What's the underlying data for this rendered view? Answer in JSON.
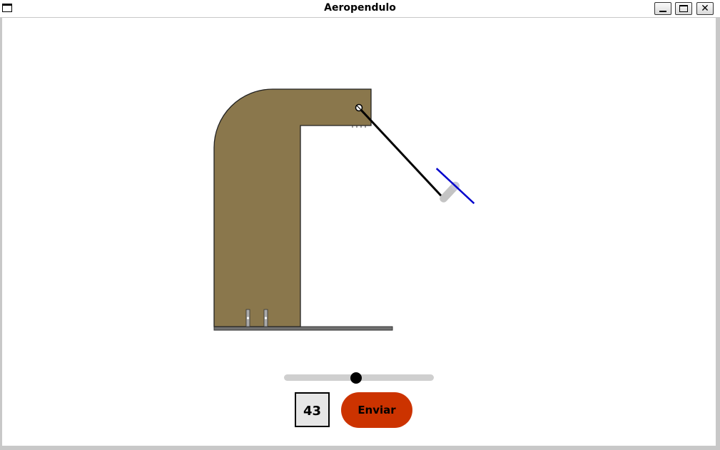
{
  "window": {
    "title": "Aeropendulo",
    "controls": {
      "minimize": "minimize-icon",
      "maximize": "maximize-icon",
      "close": "close-icon"
    }
  },
  "slider": {
    "fraction": 0.48
  },
  "value_display": "43",
  "send_label": "Enviar",
  "colors": {
    "frame": "#8a774c",
    "propeller": "#0000cc",
    "motor": "#c0c0c0",
    "send_button": "#cc3300",
    "slider_track": "#cfcfcf"
  },
  "pendulum": {
    "angle_deg": 43
  }
}
